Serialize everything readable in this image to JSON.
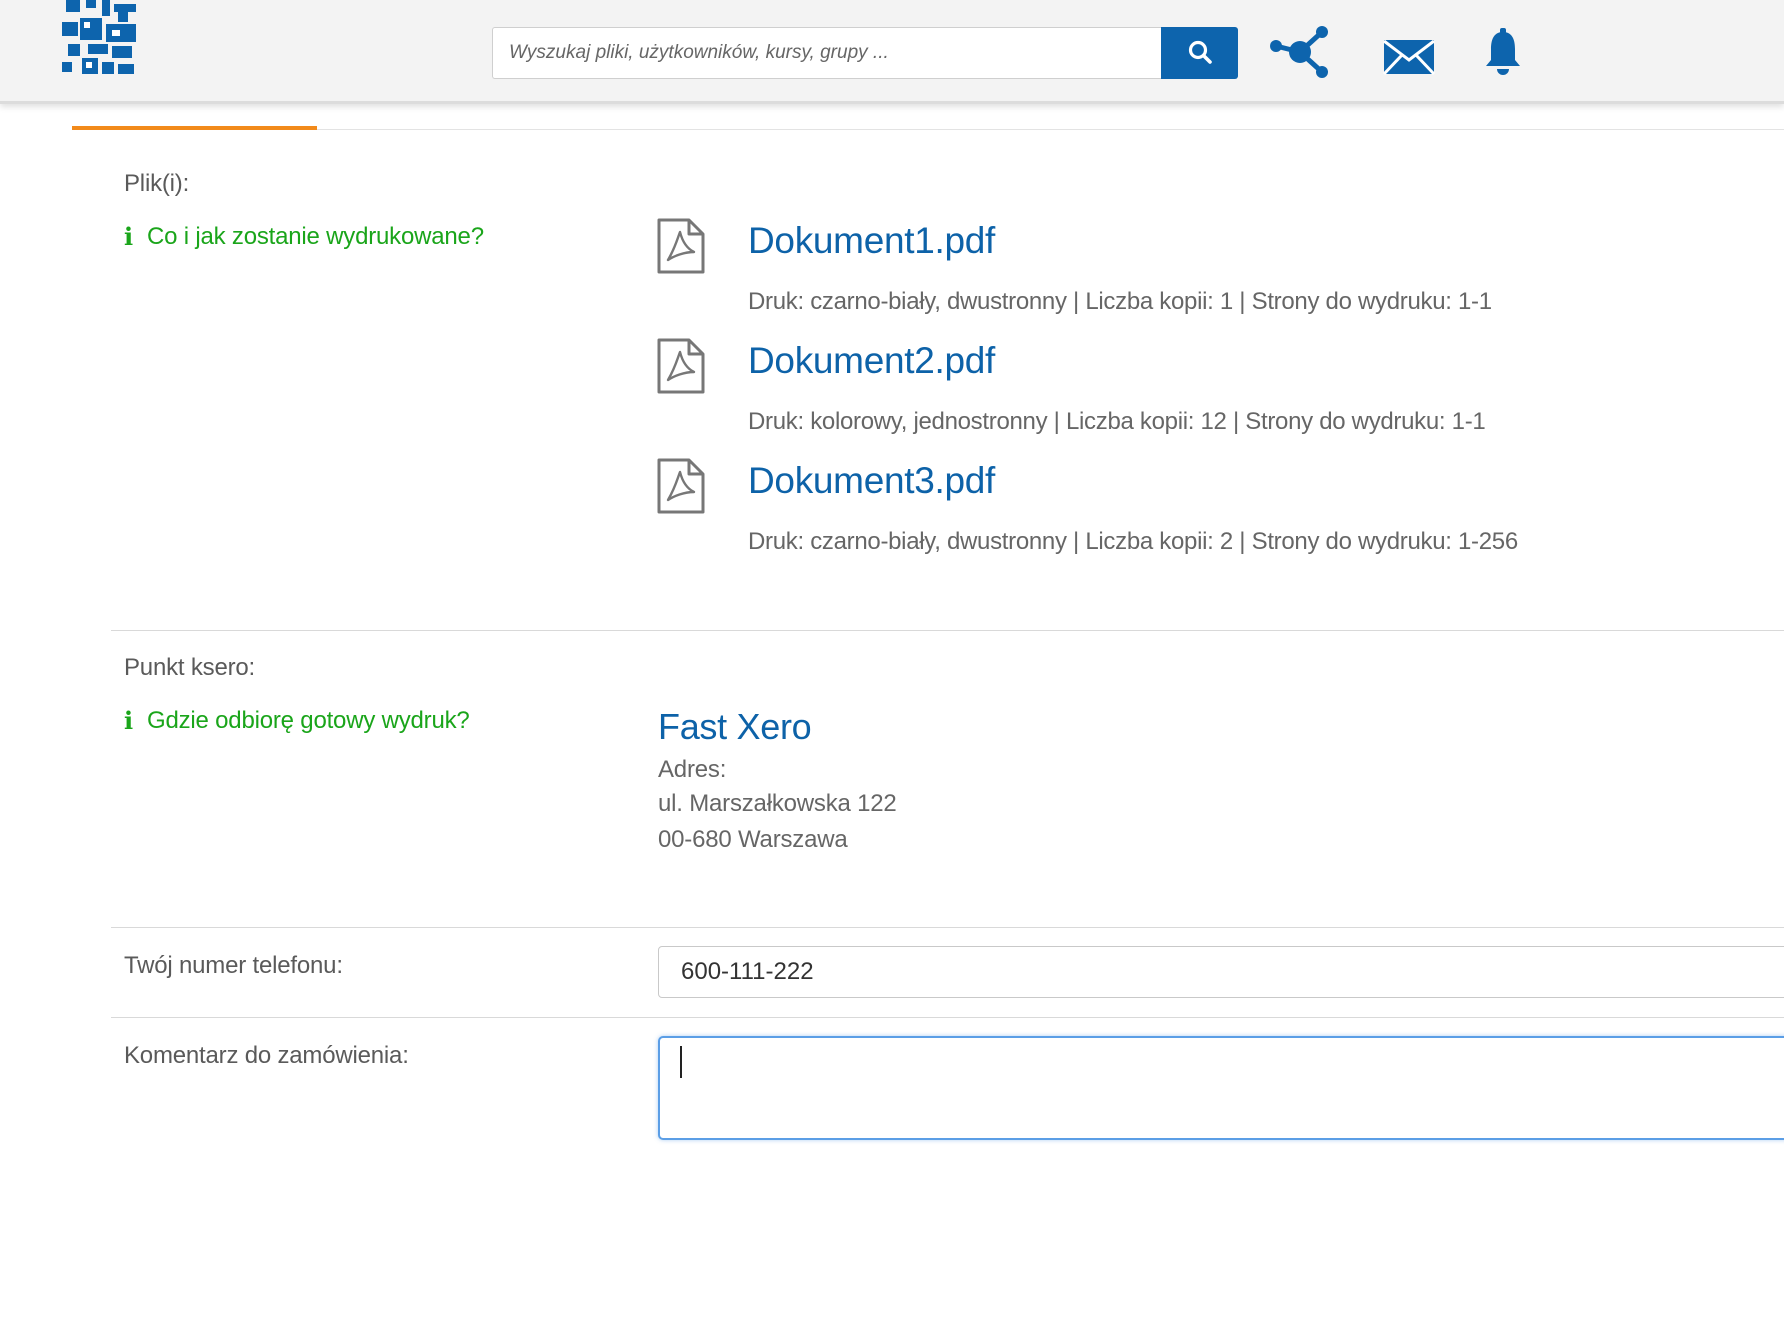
{
  "header": {
    "search_placeholder": "Wyszukaj pliki, użytkowników, kursy, grupy ...",
    "brand_color": "#0d64ad",
    "icons": [
      "logo",
      "search-icon",
      "network-icon",
      "mail-icon",
      "bell-icon"
    ]
  },
  "tabs": {
    "active_color": "#f28a1a"
  },
  "files_section": {
    "label": "Plik(i):",
    "help_link": "Co i jak zostanie wydrukowane?",
    "files": [
      {
        "name": "Dokument1.pdf",
        "details": "Druk: czarno-biały, dwustronny | Liczba kopii: 1 | Strony do wydruku: 1-1"
      },
      {
        "name": "Dokument2.pdf",
        "details": "Druk: kolorowy, jednostronny | Liczba kopii: 12 | Strony do wydruku: 1-1"
      },
      {
        "name": "Dokument3.pdf",
        "details": "Druk: czarno-biały, dwustronny | Liczba kopii: 2 | Strony do wydruku: 1-256"
      }
    ]
  },
  "xero_section": {
    "label": "Punkt ksero:",
    "help_link": "Gdzie odbiorę gotowy wydruk?",
    "name": "Fast Xero",
    "address_label": "Adres:",
    "address_line1": "ul. Marszałkowska 122",
    "address_line2": "00-680 Warszawa"
  },
  "phone_section": {
    "label": "Twój numer telefonu:",
    "value": "600-111-222"
  },
  "comment_section": {
    "label": "Komentarz do zamówienia:",
    "value": ""
  },
  "colors": {
    "link_blue": "#0d62a8",
    "help_green": "#1aa51a",
    "focus_border": "#5b9ee6"
  }
}
